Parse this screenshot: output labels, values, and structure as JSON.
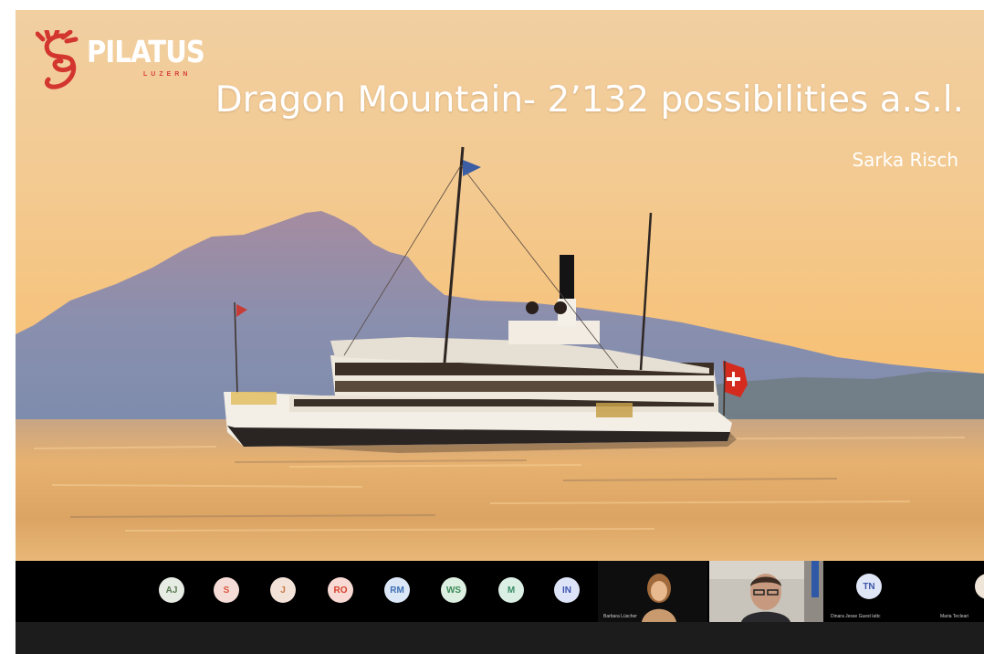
{
  "slide": {
    "logo_text": "PILATUS",
    "logo_subtext": "LUZERN",
    "title": "Dragon Mountain- 2’132 possibilities a.s.l.",
    "author": "Sarka Risch"
  },
  "participants_strip": {
    "avatars": [
      {
        "initials": "AJ",
        "bg": "#e6ece4",
        "fg": "#5b7a52"
      },
      {
        "initials": "S",
        "bg": "#f6dcd6",
        "fg": "#d9563c"
      },
      {
        "initials": "J",
        "bg": "#f3e2d8",
        "fg": "#c97a48"
      },
      {
        "initials": "RO",
        "bg": "#f8d9d3",
        "fg": "#d6422d"
      },
      {
        "initials": "RM",
        "bg": "#dbe7f6",
        "fg": "#3f6fb3"
      },
      {
        "initials": "WS",
        "bg": "#dcefe1",
        "fg": "#3c8a58"
      },
      {
        "initials": "M",
        "bg": "#dbefe5",
        "fg": "#3a8c66"
      },
      {
        "initials": "IN",
        "bg": "#dde4f7",
        "fg": "#3e55b0"
      },
      {
        "initials": "TN",
        "bg": "#dfe6f6",
        "fg": "#3e57a8"
      }
    ],
    "video_tiles": [
      {
        "name": "Barbara Lüscher"
      },
      {
        "name": ""
      },
      {
        "name": "Dinara Jesse Guest lattc"
      },
      {
        "name": "Maria Tecleari"
      }
    ]
  }
}
